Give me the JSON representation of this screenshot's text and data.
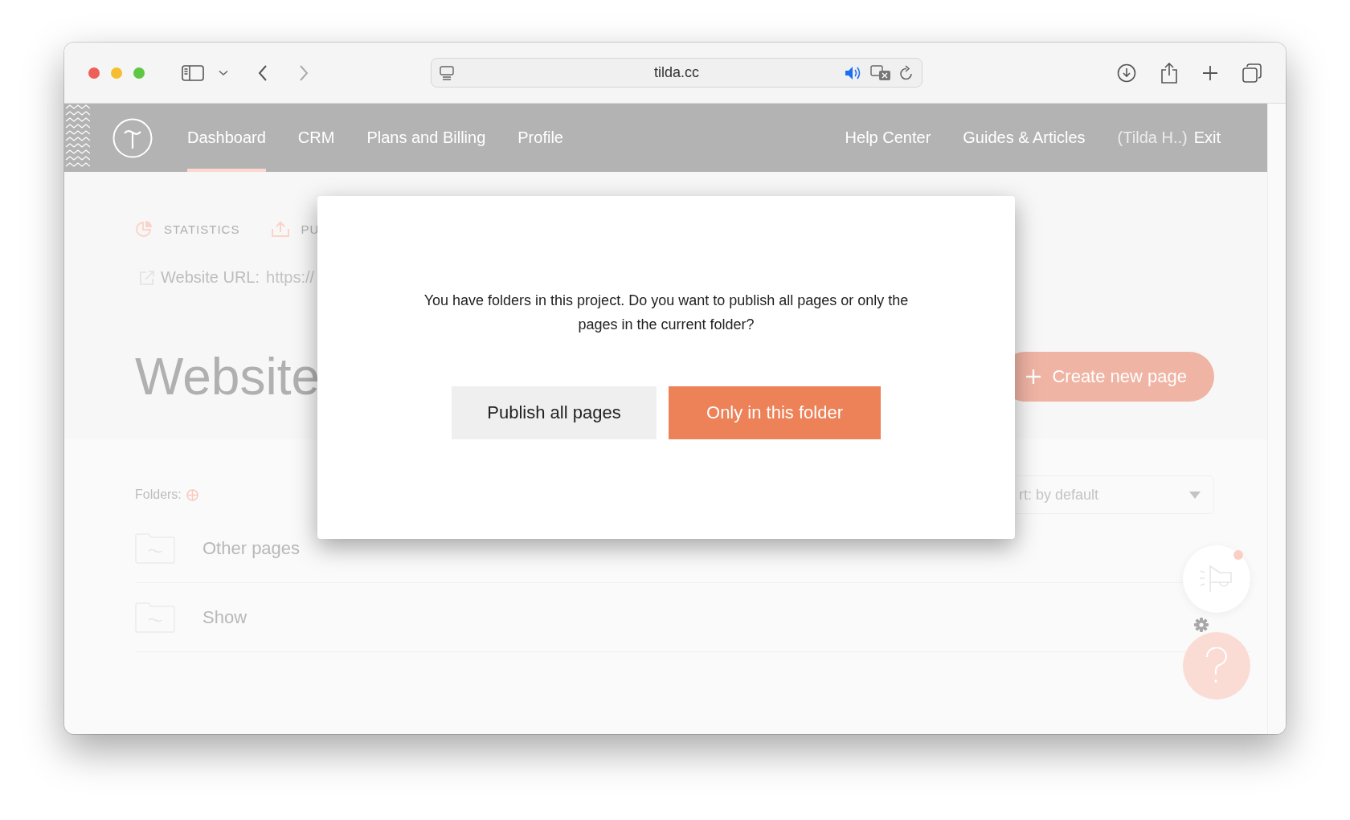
{
  "browser": {
    "url": "tilda.cc"
  },
  "nav": {
    "items": [
      {
        "label": "Dashboard",
        "selected": true
      },
      {
        "label": "CRM",
        "selected": false
      },
      {
        "label": "Plans and Billing",
        "selected": false
      },
      {
        "label": "Profile",
        "selected": false
      }
    ],
    "links": [
      "Help Center",
      "Guides & Articles"
    ],
    "account": "(Tilda H..)",
    "exit": "Exit"
  },
  "page": {
    "tabs": [
      "STATISTICS",
      "PU"
    ],
    "url_label": "Website URL:",
    "url_value": "https://",
    "title": "Website",
    "create_button": "Create new page",
    "folders_label": "Folders:",
    "sort": "rt: by default",
    "folders": [
      "Other pages",
      "Show"
    ],
    "unread_news": true
  },
  "dialog": {
    "message": "You have folders in this project. Do you want to publish all pages or only the pages in the current folder?",
    "buttons": [
      {
        "label": "Publish all pages",
        "kind": "secondary"
      },
      {
        "label": "Only in this folder",
        "kind": "primary"
      }
    ]
  }
}
